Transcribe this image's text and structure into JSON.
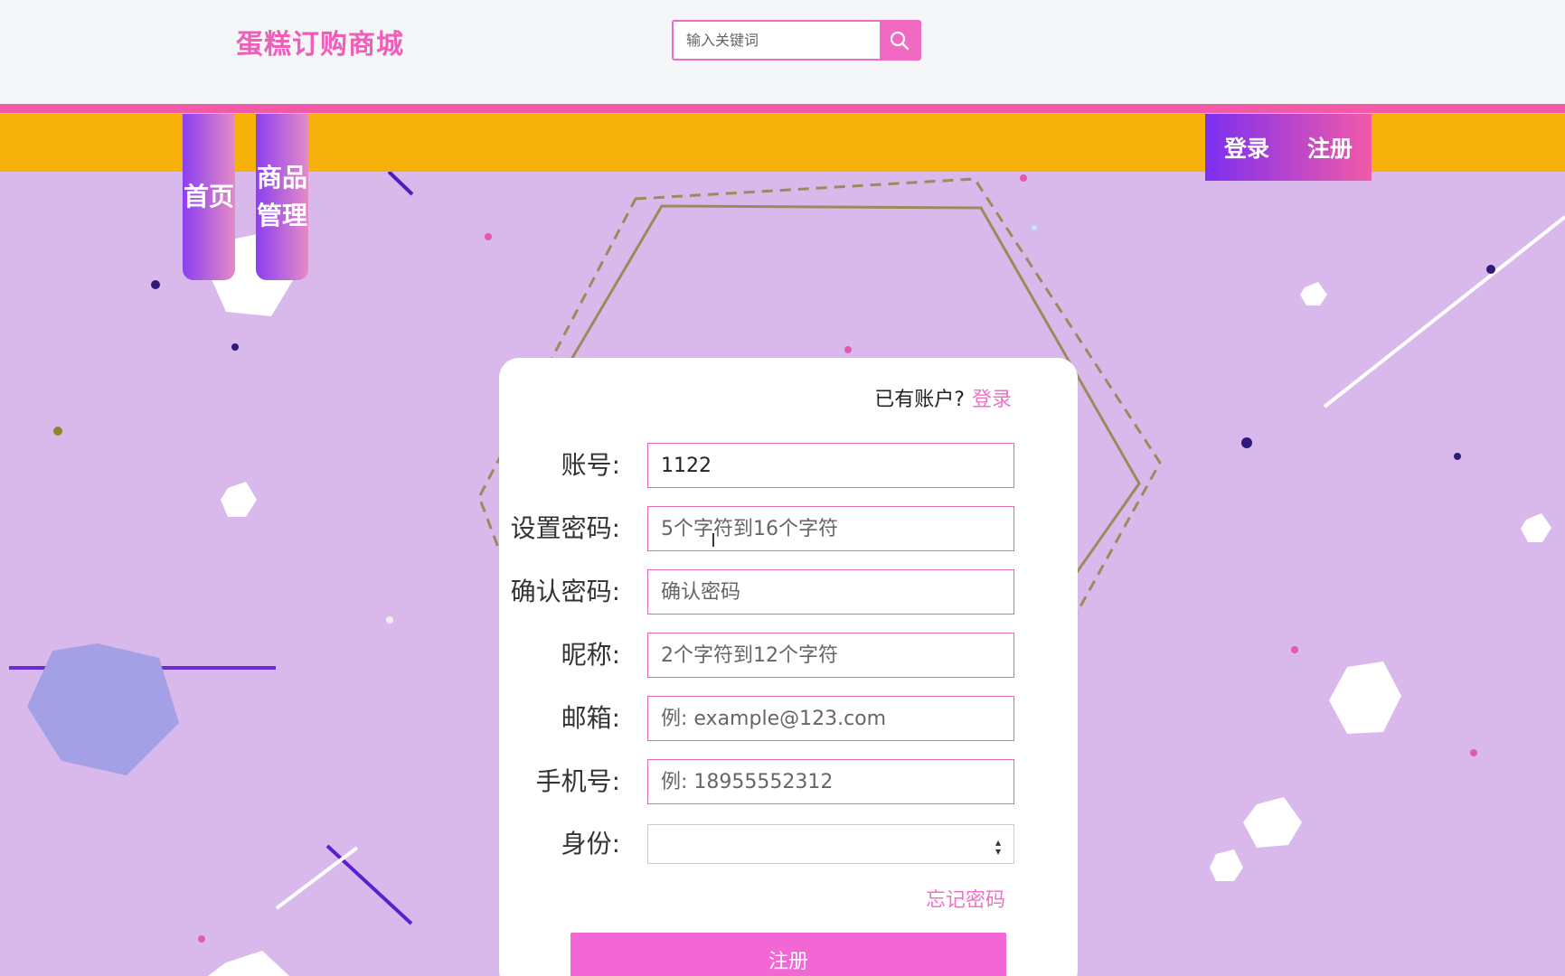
{
  "header": {
    "logo": "蛋糕订购商城",
    "search_placeholder": "输入关键词",
    "search_icon": "search-icon"
  },
  "nav": {
    "home_label": "首页",
    "goods_label_line1": "商品",
    "goods_label_line2": "管理",
    "login_label": "登录",
    "register_label": "注册"
  },
  "form": {
    "has_account_text": "已有账户?",
    "login_link": "登录",
    "fields": [
      {
        "label": "账号:",
        "value": "1122",
        "placeholder": ""
      },
      {
        "label": "设置密码:",
        "value": "",
        "placeholder": "5个字符到16个字符"
      },
      {
        "label": "确认密码:",
        "value": "",
        "placeholder": "确认密码"
      },
      {
        "label": "昵称:",
        "value": "",
        "placeholder": "2个字符到12个字符"
      },
      {
        "label": "邮箱:",
        "value": "",
        "placeholder": "例: example@123.com"
      },
      {
        "label": "手机号:",
        "value": "",
        "placeholder": "例: 18955552312"
      },
      {
        "label": "身份:",
        "value": "",
        "placeholder": ""
      }
    ],
    "forgot_password": "忘记密码",
    "submit_label": "注册"
  },
  "colors": {
    "accent_pink": "#f25aa8",
    "nav_yellow": "#f5b10a",
    "background": "#d9b8eb"
  }
}
